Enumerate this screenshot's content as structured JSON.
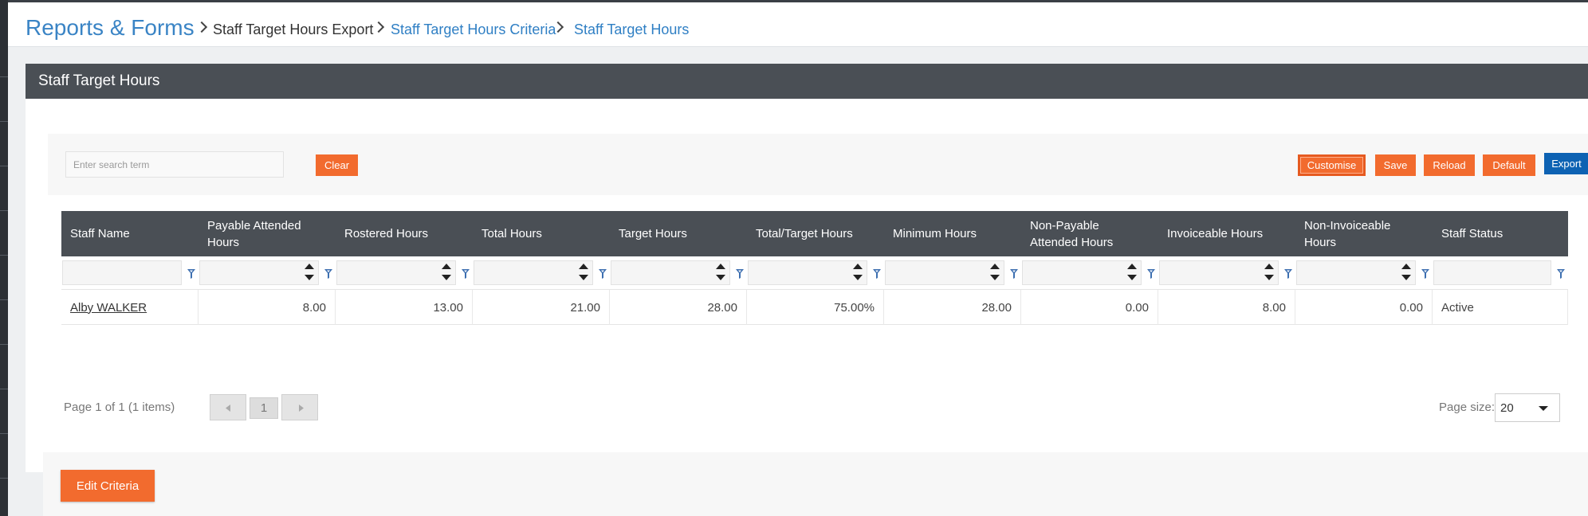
{
  "breadcrumb": {
    "root": "Reports & Forms",
    "items": [
      {
        "label": "Staff Target Hours Export",
        "style": "dark"
      },
      {
        "label": "Staff Target Hours Criteria",
        "style": "link"
      },
      {
        "label": "Staff Target Hours",
        "style": "link"
      }
    ]
  },
  "panel": {
    "title": "Staff Target Hours"
  },
  "toolbar": {
    "search_placeholder": "Enter search term",
    "clear_label": "Clear",
    "customise_label": "Customise",
    "save_label": "Save",
    "reload_label": "Reload",
    "default_label": "Default",
    "export_label": "Export"
  },
  "grid": {
    "columns": [
      {
        "label": "Staff Name",
        "align": "left",
        "filter": "text"
      },
      {
        "label": "Payable Attended Hours",
        "align": "right",
        "filter": "numeric"
      },
      {
        "label": "Rostered Hours",
        "align": "right",
        "filter": "numeric"
      },
      {
        "label": "Total Hours",
        "align": "right",
        "filter": "numeric"
      },
      {
        "label": "Target Hours",
        "align": "right",
        "filter": "numeric"
      },
      {
        "label": "Total/Target Hours",
        "align": "right",
        "filter": "numeric"
      },
      {
        "label": "Minimum Hours",
        "align": "right",
        "filter": "numeric"
      },
      {
        "label": "Non-Payable Attended Hours",
        "align": "right",
        "filter": "numeric"
      },
      {
        "label": "Invoiceable Hours",
        "align": "right",
        "filter": "numeric"
      },
      {
        "label": "Non-Invoiceable Hours",
        "align": "right",
        "filter": "numeric"
      },
      {
        "label": "Staff Status",
        "align": "left",
        "filter": "text"
      }
    ],
    "rows": [
      [
        "Alby WALKER",
        "8.00",
        "13.00",
        "21.00",
        "28.00",
        "75.00%",
        "28.00",
        "0.00",
        "8.00",
        "0.00",
        "Active"
      ]
    ]
  },
  "pager": {
    "info": "Page 1 of 1 (1 items)",
    "current_page": "1",
    "page_size_label": "Page size:",
    "page_size_value": "20"
  },
  "footer": {
    "edit_criteria_label": "Edit Criteria"
  },
  "colors": {
    "accent_orange": "#f26b2e",
    "export_blue": "#0d62b3",
    "header_dark": "#4a4f55",
    "link_blue": "#2f7fc4"
  }
}
